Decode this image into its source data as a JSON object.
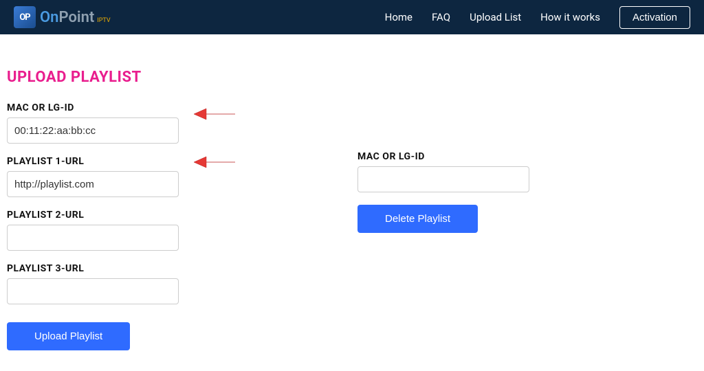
{
  "logo": {
    "brand_prefix": "On",
    "brand_suffix": "Point",
    "brand_sub": "IPTV"
  },
  "nav": {
    "home": "Home",
    "faq": "FAQ",
    "upload": "Upload List",
    "how": "How it works",
    "activation": "Activation"
  },
  "page": {
    "title": "UPLOAD PLAYLIST",
    "mac_label": "MAC OR LG-ID",
    "mac_value": "00:11:22:aa:bb:cc",
    "playlist1_label": "PLAYLIST 1-URL",
    "playlist1_value": "http://playlist.com",
    "playlist2_label": "PLAYLIST 2-URL",
    "playlist2_value": "",
    "playlist3_label": "PLAYLIST 3-URL",
    "playlist3_value": "",
    "upload_button": "Upload Playlist"
  },
  "delete_panel": {
    "mac_label": "MAC OR LG-ID",
    "mac_value": "",
    "delete_button": "Delete Playlist"
  },
  "colors": {
    "navbar_bg": "#0d2640",
    "accent_pink": "#e91e8e",
    "button_blue": "#2f6bff",
    "arrow_red": "#e53935"
  }
}
